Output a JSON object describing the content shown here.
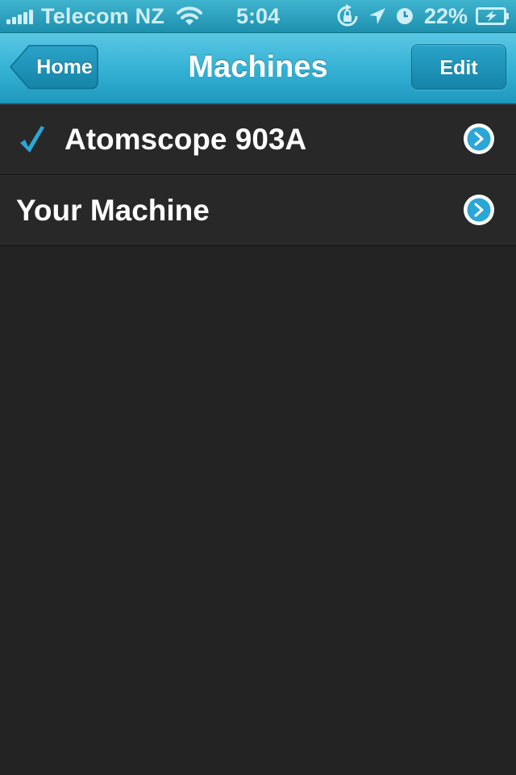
{
  "status_bar": {
    "carrier": "Telecom NZ",
    "time": "5:04",
    "battery": "22%",
    "icons": [
      "signal-icon",
      "wifi-icon",
      "rotation-lock-icon",
      "location-icon",
      "alarm-icon",
      "battery-charging-icon"
    ]
  },
  "nav": {
    "title": "Machines",
    "back_label": "Home",
    "edit_label": "Edit"
  },
  "machines": [
    {
      "name": "Atomscope 903A",
      "selected": true
    },
    {
      "name": "Your Machine",
      "selected": false
    }
  ],
  "colors": {
    "accent": "#2aa7d6",
    "nav_bar": "#32b0d3",
    "background": "#232323",
    "row": "#282828"
  }
}
